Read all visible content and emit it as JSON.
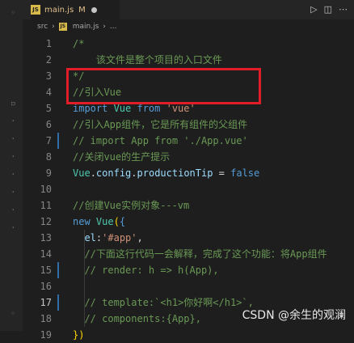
{
  "tab": {
    "filename": "main.js",
    "status": "M"
  },
  "breadcrumb": {
    "folder": "src",
    "sep": "›",
    "file": "main.js",
    "tail": "..."
  },
  "lines": [
    {
      "num": "1",
      "parts": [
        {
          "t": "/*",
          "c": "comment"
        }
      ]
    },
    {
      "num": "2",
      "parts": [
        {
          "t": "    该文件是整个项目的入口文件",
          "c": "comment"
        }
      ]
    },
    {
      "num": "3",
      "parts": [
        {
          "t": "*/",
          "c": "comment"
        }
      ]
    },
    {
      "num": "4",
      "parts": [
        {
          "t": "//引入Vue",
          "c": "comment"
        }
      ]
    },
    {
      "num": "5",
      "parts": [
        {
          "t": "import ",
          "c": "kw"
        },
        {
          "t": "Vue ",
          "c": "ident"
        },
        {
          "t": "from ",
          "c": "kw"
        },
        {
          "t": "'vue'",
          "c": "str"
        }
      ]
    },
    {
      "num": "6",
      "parts": [
        {
          "t": "//引入App组件，它是所有组件的父组件",
          "c": "comment"
        }
      ]
    },
    {
      "num": "7",
      "parts": [
        {
          "t": "// import App from './App.vue'",
          "c": "comment"
        }
      ]
    },
    {
      "num": "8",
      "parts": [
        {
          "t": "//关闭vue的生产提示",
          "c": "comment"
        }
      ]
    },
    {
      "num": "9",
      "parts": [
        {
          "t": "Vue",
          "c": "ident"
        },
        {
          "t": ".",
          "c": "punc"
        },
        {
          "t": "config",
          "c": "prop"
        },
        {
          "t": ".",
          "c": "punc"
        },
        {
          "t": "productionTip",
          "c": "prop"
        },
        {
          "t": " = ",
          "c": "punc"
        },
        {
          "t": "false",
          "c": "kw"
        }
      ]
    },
    {
      "num": "10",
      "parts": []
    },
    {
      "num": "11",
      "parts": [
        {
          "t": "//创建Vue实例对象---vm",
          "c": "comment"
        }
      ]
    },
    {
      "num": "12",
      "parts": [
        {
          "t": "new ",
          "c": "kw"
        },
        {
          "t": "Vue",
          "c": "ident"
        },
        {
          "t": "(",
          "c": "brace"
        },
        {
          "t": "{",
          "c": "cur"
        }
      ]
    },
    {
      "num": "13",
      "parts": [
        {
          "t": "  el",
          "c": "prop"
        },
        {
          "t": ":",
          "c": "punc"
        },
        {
          "t": "'#app'",
          "c": "str"
        },
        {
          "t": ",",
          "c": "punc"
        }
      ]
    },
    {
      "num": "14",
      "parts": [
        {
          "t": "  //下面这行代码一会解释，完成了这个功能：将App组件",
          "c": "comment"
        }
      ]
    },
    {
      "num": "15",
      "parts": [
        {
          "t": "  // render: h => h(App),",
          "c": "comment"
        }
      ]
    },
    {
      "num": "16",
      "parts": []
    },
    {
      "num": "17",
      "parts": [
        {
          "t": "  // template:`<h1>你好啊</h1>`,",
          "c": "comment"
        }
      ]
    },
    {
      "num": "18",
      "parts": [
        {
          "t": "  // components:{App},",
          "c": "comment"
        }
      ]
    },
    {
      "num": "19",
      "parts": [
        {
          "t": "})",
          "c": "brace"
        }
      ]
    }
  ],
  "activity_marks": [
    "◦",
    "▫",
    "·",
    "·",
    "·",
    "·",
    "·",
    "·",
    "·",
    "◦"
  ],
  "watermark": "CSDN @余生的观澜",
  "colors": {
    "highlight": "#e11d2a",
    "accent": "#2f6ea8"
  },
  "icons": {
    "run": "▷",
    "split": "◫",
    "more": "⋯"
  }
}
